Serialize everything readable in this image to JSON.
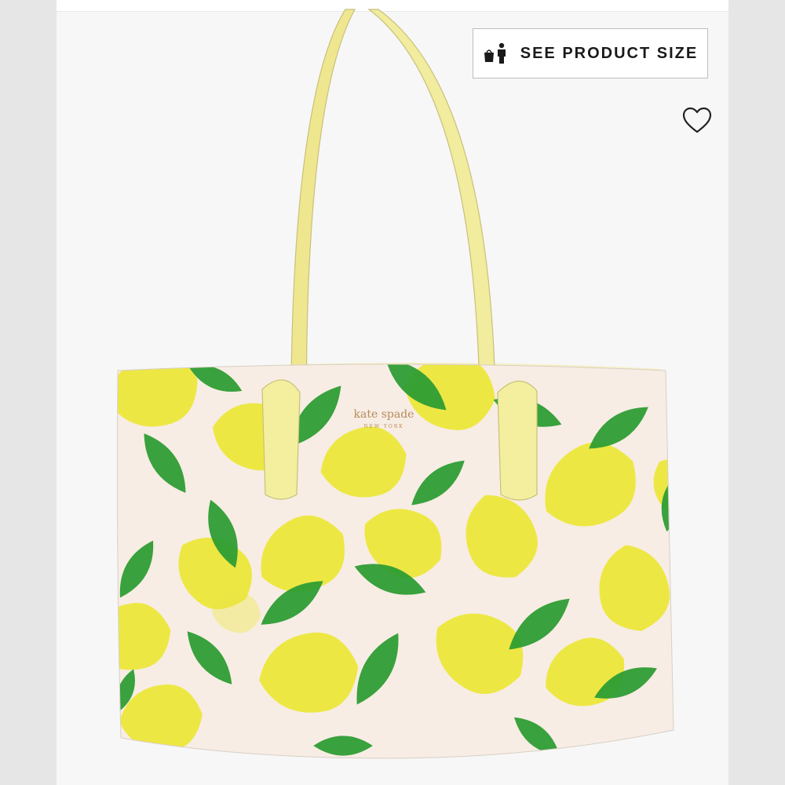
{
  "header": {
    "partial_text": ""
  },
  "product_image": {
    "size_button": {
      "label": "SEE PRODUCT SIZE",
      "icon": "person-with-bag-icon"
    },
    "favorite_button": {
      "icon": "heart-outline-icon"
    },
    "brand_logo": {
      "name": "kate spade",
      "sub": "NEW YORK"
    }
  },
  "colors": {
    "lemon": "#ecea3a",
    "leaf": "#2f9e34",
    "canvas": "#f7ede4",
    "strap": "#f2ef9c"
  }
}
